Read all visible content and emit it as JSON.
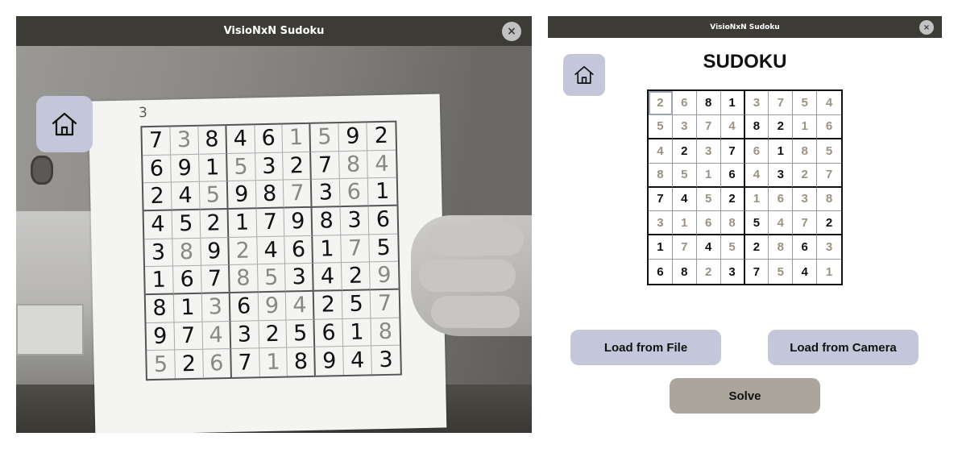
{
  "camera_window": {
    "title": "VisioNxN Sudoku",
    "close_label": "×",
    "home_icon": "home-icon",
    "paper_note": "3",
    "photo_grid": [
      [
        [
          "7",
          "g"
        ],
        [
          "3",
          "f"
        ],
        [
          "8",
          "g"
        ],
        [
          "4",
          "g"
        ],
        [
          "6",
          "g"
        ],
        [
          "1",
          "f"
        ],
        [
          "5",
          "f"
        ],
        [
          "9",
          "g"
        ],
        [
          "2",
          "g"
        ]
      ],
      [
        [
          "6",
          "g"
        ],
        [
          "9",
          "g"
        ],
        [
          "1",
          "g"
        ],
        [
          "5",
          "f"
        ],
        [
          "3",
          "g"
        ],
        [
          "2",
          "g"
        ],
        [
          "7",
          "g"
        ],
        [
          "8",
          "f"
        ],
        [
          "4",
          "f"
        ]
      ],
      [
        [
          "2",
          "g"
        ],
        [
          "4",
          "g"
        ],
        [
          "5",
          "f"
        ],
        [
          "9",
          "g"
        ],
        [
          "8",
          "g"
        ],
        [
          "7",
          "f"
        ],
        [
          "3",
          "g"
        ],
        [
          "6",
          "f"
        ],
        [
          "1",
          "g"
        ]
      ],
      [
        [
          "4",
          "g"
        ],
        [
          "5",
          "g"
        ],
        [
          "2",
          "g"
        ],
        [
          "1",
          "g"
        ],
        [
          "7",
          "g"
        ],
        [
          "9",
          "g"
        ],
        [
          "8",
          "g"
        ],
        [
          "3",
          "g"
        ],
        [
          "6",
          "g"
        ]
      ],
      [
        [
          "3",
          "g"
        ],
        [
          "8",
          "f"
        ],
        [
          "9",
          "g"
        ],
        [
          "2",
          "f"
        ],
        [
          "4",
          "g"
        ],
        [
          "6",
          "g"
        ],
        [
          "1",
          "g"
        ],
        [
          "7",
          "f"
        ],
        [
          "5",
          "g"
        ]
      ],
      [
        [
          "1",
          "g"
        ],
        [
          "6",
          "g"
        ],
        [
          "7",
          "g"
        ],
        [
          "8",
          "f"
        ],
        [
          "5",
          "f"
        ],
        [
          "3",
          "g"
        ],
        [
          "4",
          "g"
        ],
        [
          "2",
          "g"
        ],
        [
          "9",
          "f"
        ]
      ],
      [
        [
          "8",
          "g"
        ],
        [
          "1",
          "g"
        ],
        [
          "3",
          "f"
        ],
        [
          "6",
          "g"
        ],
        [
          "9",
          "f"
        ],
        [
          "4",
          "f"
        ],
        [
          "2",
          "g"
        ],
        [
          "5",
          "g"
        ],
        [
          "7",
          "f"
        ]
      ],
      [
        [
          "9",
          "g"
        ],
        [
          "7",
          "g"
        ],
        [
          "4",
          "f"
        ],
        [
          "3",
          "g"
        ],
        [
          "2",
          "g"
        ],
        [
          "5",
          "g"
        ],
        [
          "6",
          "g"
        ],
        [
          "1",
          "g"
        ],
        [
          "8",
          "f"
        ]
      ],
      [
        [
          "5",
          "f"
        ],
        [
          "2",
          "g"
        ],
        [
          "6",
          "f"
        ],
        [
          "7",
          "g"
        ],
        [
          "1",
          "f"
        ],
        [
          "8",
          "g"
        ],
        [
          "9",
          "g"
        ],
        [
          "4",
          "g"
        ],
        [
          "3",
          "g"
        ]
      ]
    ]
  },
  "app_window": {
    "title": "VisioNxN Sudoku",
    "close_label": "×",
    "home_icon": "home-icon",
    "heading": "SUDOKU",
    "grid": [
      [
        [
          "2",
          "s"
        ],
        [
          "6",
          "s"
        ],
        [
          "8",
          "g"
        ],
        [
          "1",
          "g"
        ],
        [
          "3",
          "s"
        ],
        [
          "7",
          "s"
        ],
        [
          "5",
          "s"
        ],
        [
          "4",
          "s"
        ]
      ],
      [
        [
          "5",
          "s"
        ],
        [
          "3",
          "s"
        ],
        [
          "7",
          "s"
        ],
        [
          "4",
          "s"
        ],
        [
          "8",
          "g"
        ],
        [
          "2",
          "g"
        ],
        [
          "1",
          "s"
        ],
        [
          "6",
          "s"
        ]
      ],
      [
        [
          "4",
          "s"
        ],
        [
          "2",
          "g"
        ],
        [
          "3",
          "s"
        ],
        [
          "7",
          "g"
        ],
        [
          "6",
          "s"
        ],
        [
          "1",
          "g"
        ],
        [
          "8",
          "s"
        ],
        [
          "5",
          "s"
        ]
      ],
      [
        [
          "8",
          "s"
        ],
        [
          "5",
          "s"
        ],
        [
          "1",
          "s"
        ],
        [
          "6",
          "g"
        ],
        [
          "4",
          "s"
        ],
        [
          "3",
          "g"
        ],
        [
          "2",
          "s"
        ],
        [
          "7",
          "s"
        ]
      ],
      [
        [
          "7",
          "g"
        ],
        [
          "4",
          "g"
        ],
        [
          "5",
          "s"
        ],
        [
          "2",
          "g"
        ],
        [
          "1",
          "s"
        ],
        [
          "6",
          "s"
        ],
        [
          "3",
          "s"
        ],
        [
          "8",
          "s"
        ]
      ],
      [
        [
          "3",
          "s"
        ],
        [
          "1",
          "s"
        ],
        [
          "6",
          "s"
        ],
        [
          "8",
          "s"
        ],
        [
          "5",
          "g"
        ],
        [
          "4",
          "s"
        ],
        [
          "7",
          "s"
        ],
        [
          "2",
          "g"
        ]
      ],
      [
        [
          "1",
          "g"
        ],
        [
          "7",
          "s"
        ],
        [
          "4",
          "g"
        ],
        [
          "5",
          "s"
        ],
        [
          "2",
          "g"
        ],
        [
          "8",
          "s"
        ],
        [
          "6",
          "g"
        ],
        [
          "3",
          "s"
        ]
      ],
      [
        [
          "6",
          "g"
        ],
        [
          "8",
          "g"
        ],
        [
          "2",
          "s"
        ],
        [
          "3",
          "g"
        ],
        [
          "7",
          "g"
        ],
        [
          "5",
          "s"
        ],
        [
          "4",
          "g"
        ],
        [
          "1",
          "s"
        ]
      ]
    ],
    "buttons": {
      "load_file": "Load from File",
      "load_camera": "Load from Camera",
      "solve": "Solve"
    },
    "colors": {
      "button_blue": "#c4c7d9",
      "button_solve": "#aaa69c",
      "titlebar": "#3d3b36",
      "solved_digit": "#9a9283"
    }
  }
}
